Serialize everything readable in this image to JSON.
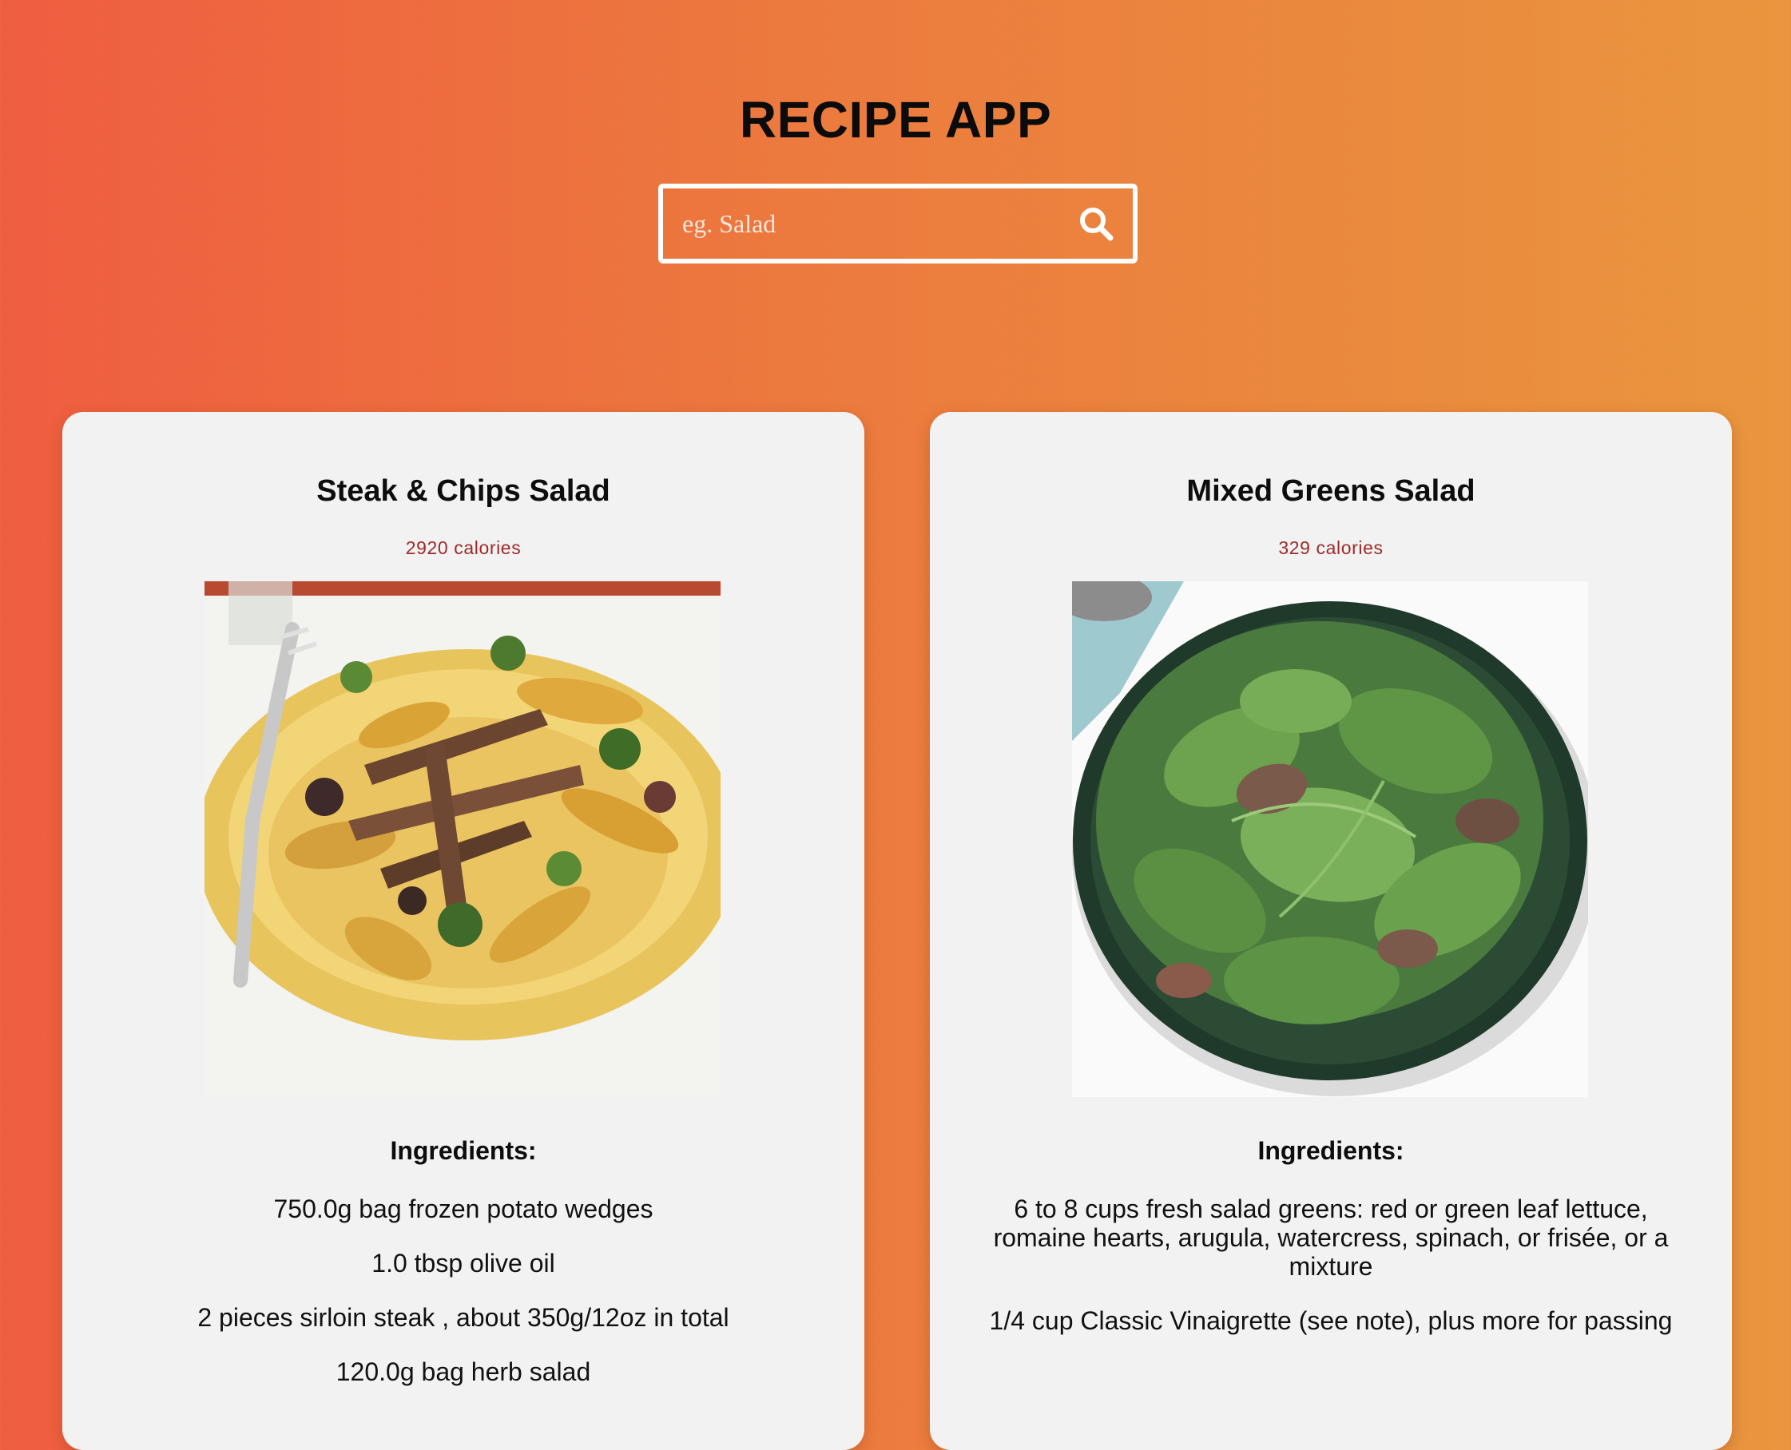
{
  "header": {
    "title": "RECIPE APP"
  },
  "search": {
    "placeholder": "eg. Salad",
    "value": "",
    "icon": "search-icon"
  },
  "recipes": [
    {
      "title": "Steak & Chips Salad",
      "calories": "2920 calories",
      "ingredients_heading": "Ingredients:",
      "ingredients": [
        "750.0g bag frozen potato wedges",
        "1.0 tbsp olive oil",
        "2 pieces sirloin steak , about 350g/12oz in total",
        "120.0g bag herb salad"
      ]
    },
    {
      "title": "Mixed Greens Salad",
      "calories": "329 calories",
      "ingredients_heading": "Ingredients:",
      "ingredients": [
        "6 to 8 cups fresh salad greens: red or green leaf lettuce, romaine hearts, arugula, watercress, spinach, or frisée, or a mixture",
        "1/4 cup Classic Vinaigrette (see note), plus more for passing"
      ]
    }
  ],
  "colors": {
    "gradient_start": "#ef5d40",
    "gradient_end": "#e9963e",
    "card_background": "#f2f2f2",
    "calories_text": "#9e2a2a"
  }
}
